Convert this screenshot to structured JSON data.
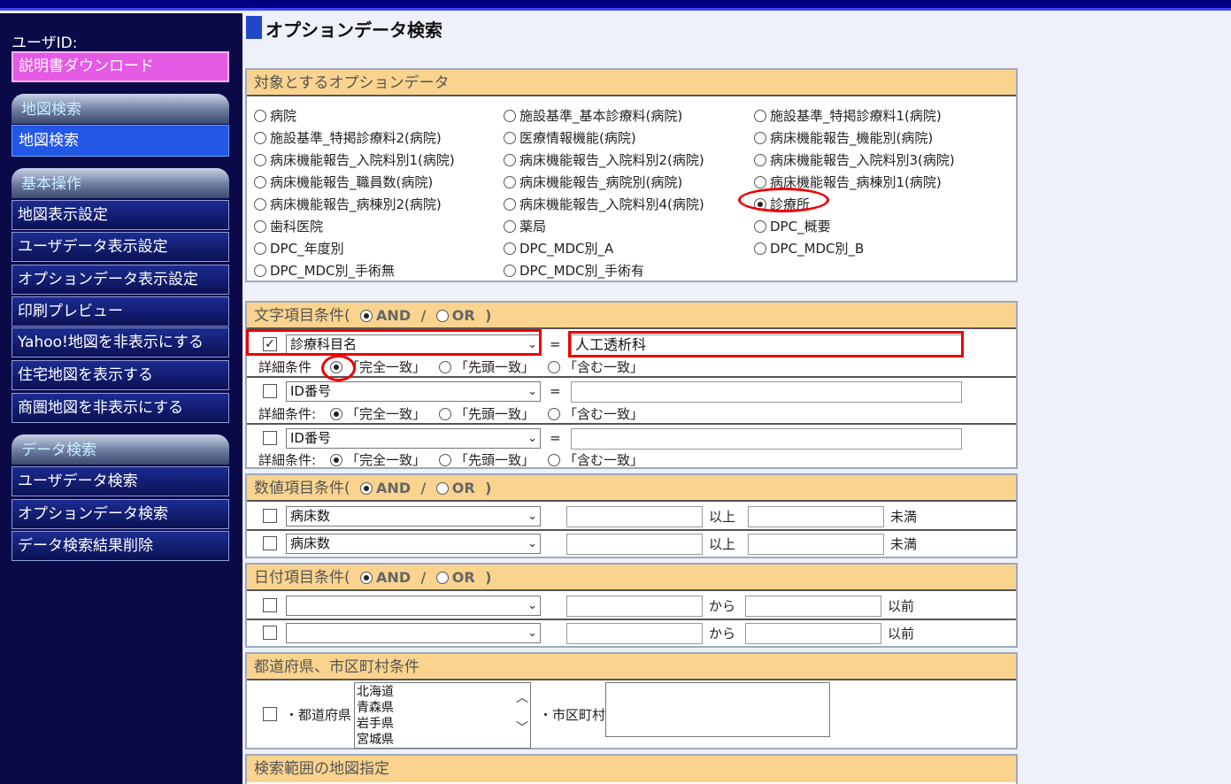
{
  "sidebar": {
    "user_id_label": "ユーザID:",
    "manual_download": "説明書ダウンロード",
    "sections": [
      {
        "header": "地図検索",
        "items": [
          "地図検索"
        ]
      },
      {
        "header": "基本操作",
        "items": [
          "地図表示設定",
          "ユーザデータ表示設定",
          "オプションデータ表示設定",
          "印刷プレビュー",
          "Yahoo!地図を非表示にする",
          "住宅地図を表示する",
          "商圏地図を非表示にする"
        ]
      },
      {
        "header": "データ検索",
        "items": [
          "ユーザデータ検索",
          "オプションデータ検索",
          "データ検索結果削除"
        ]
      }
    ]
  },
  "main": {
    "title": "オプションデータ検索",
    "target": {
      "header": "対象とするオプションデータ",
      "options": [
        "病院",
        "施設基準_基本診療料(病院)",
        "施設基準_特掲診療料1(病院)",
        "施設基準_特掲診療料2(病院)",
        "医療情報機能(病院)",
        "病床機能報告_機能別(病院)",
        "病床機能報告_入院料別1(病院)",
        "病床機能報告_入院料別2(病院)",
        "病床機能報告_入院料別3(病院)",
        "病床機能報告_職員数(病院)",
        "病床機能報告_病院別(病院)",
        "病床機能報告_病棟別1(病院)",
        "病床機能報告_病棟別2(病院)",
        "病床機能報告_入院料別4(病院)",
        "診療所",
        "歯科医院",
        "薬局",
        "DPC_概要",
        "DPC_年度別",
        "DPC_MDC別_A",
        "DPC_MDC別_B",
        "DPC_MDC別_手術無",
        "DPC_MDC別_手術有"
      ],
      "selected": "診療所"
    },
    "text_cond": {
      "header": "文字項目条件(",
      "and_label": "AND",
      "sep": "/",
      "or_label": "OR",
      "close": ")",
      "detail_label": "詳細条件",
      "detail_label_colon": "詳細条件:",
      "match_exact": "「完全一致」",
      "match_prefix": "「先頭一致」",
      "match_contains": "「含む一致」",
      "eq": "=",
      "rows": [
        {
          "checked": "✓",
          "field": "診療科目名",
          "value": "人工透析科"
        },
        {
          "checked": "",
          "field": "ID番号",
          "value": ""
        },
        {
          "checked": "",
          "field": "ID番号",
          "value": ""
        }
      ]
    },
    "num_cond": {
      "header": "数値項目条件(",
      "and_label": "AND",
      "sep": "/",
      "or_label": "OR",
      "close": ")",
      "ge": "以上",
      "lt": "未満",
      "rows": [
        {
          "field": "病床数"
        },
        {
          "field": "病床数"
        }
      ]
    },
    "date_cond": {
      "header": "日付項目条件(",
      "and_label": "AND",
      "sep": "/",
      "or_label": "OR",
      "close": ")",
      "from": "から",
      "before": "以前",
      "rows": [
        {
          "field": ""
        },
        {
          "field": ""
        }
      ]
    },
    "pref_cond": {
      "header": "都道府県、市区町村条件",
      "pref_label": "・都道府県",
      "prefectures": [
        "北海道",
        "青森県",
        "岩手県",
        "宮城県"
      ],
      "city_label": "・市区町村"
    },
    "map_range": {
      "header": "検索範囲の地図指定"
    }
  },
  "icons": {
    "dropdown": "chevron-down-icon",
    "scroll_up": "chevron-up-icon",
    "scroll_down": "chevron-down-icon"
  },
  "colors": {
    "sidebar_bg": "#0a0a48",
    "panel_header": "#fad48e",
    "highlight": "#e00000",
    "download_btn": "#e45ae4"
  }
}
